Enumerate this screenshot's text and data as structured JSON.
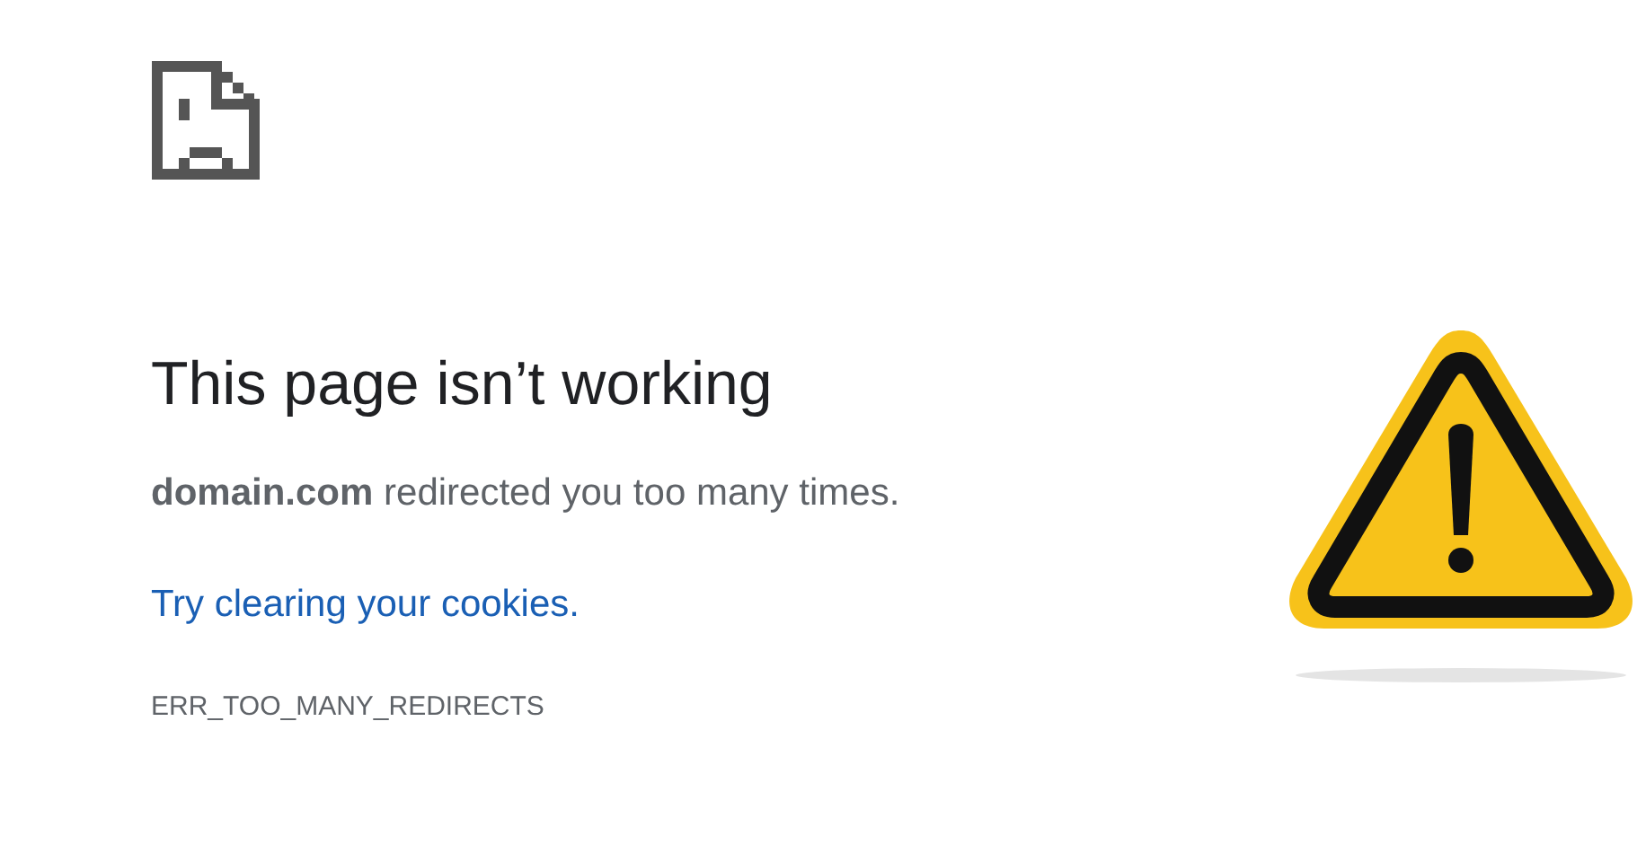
{
  "error": {
    "title": "This page isn’t working",
    "message": "**domain.com** redirected you too many times.",
    "suggestion_link": "Try clearing your cookies.",
    "code": "ERR_TOO_MANY_REDIRECTS"
  }
}
